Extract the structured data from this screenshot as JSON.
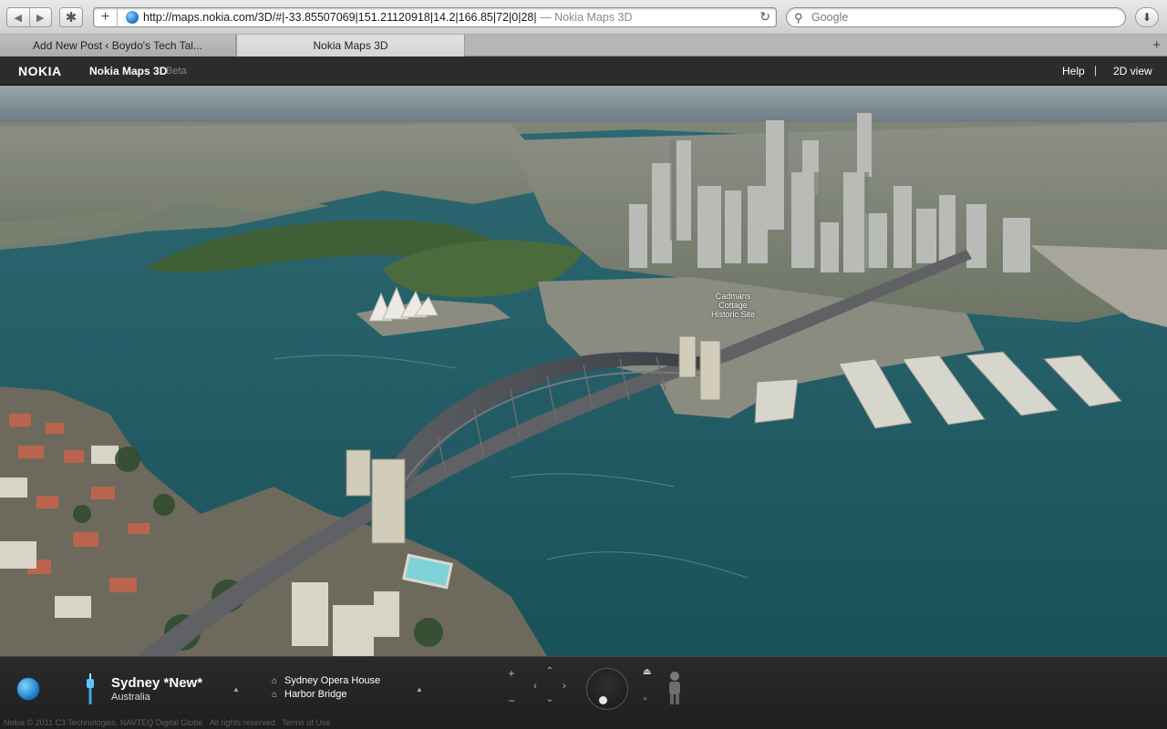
{
  "browser": {
    "url": "http://maps.nokia.com/3D/#|-33.85507069|151.21120918|14.2|166.85|72|0|28|",
    "url_title_suffix": "— Nokia Maps 3D",
    "search_placeholder": "Google",
    "tabs": [
      {
        "label": "Add New Post ‹ Boydo's Tech Tal...",
        "active": false
      },
      {
        "label": "Nokia Maps 3D",
        "active": true
      }
    ]
  },
  "header": {
    "logo": "NOKIA",
    "title": "Nokia Maps 3D",
    "beta": "Beta",
    "help": "Help",
    "separator": "|",
    "view_toggle": "2D view"
  },
  "map": {
    "label_line1": "Cadmans",
    "label_line2": "Cottage",
    "label_line3": "Historic Site",
    "water_color": "#1d5a62"
  },
  "panel": {
    "city": "Sydney *New*",
    "country": "Australia",
    "pois": [
      "Sydney Opera House",
      "Harbor Bridge"
    ],
    "copyright": "Nokia © 2011 C3 Technologies, NAVTEQ Digital Globe",
    "rights": "All rights reserved",
    "terms": "Terms of Use"
  }
}
